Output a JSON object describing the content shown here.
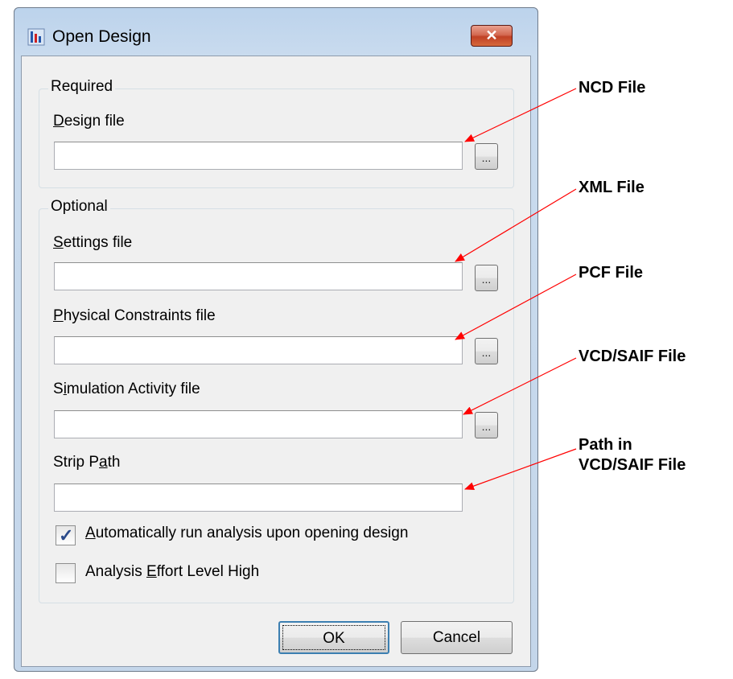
{
  "window": {
    "title": "Open Design",
    "close_glyph": "✕"
  },
  "required_group": {
    "label": "Required",
    "design_file": {
      "mnemonic": "D",
      "rest": "esign file",
      "value": ""
    }
  },
  "optional_group": {
    "label": "Optional",
    "settings_file": {
      "mnemonic": "S",
      "rest": "ettings file",
      "value": ""
    },
    "physical_constraints_file": {
      "mnemonic": "P",
      "rest": "hysical Constraints file",
      "value": ""
    },
    "simulation_activity_file": {
      "pre": "S",
      "mnemonic": "i",
      "rest": "mulation Activity file",
      "value": ""
    },
    "strip_path": {
      "pre": "Strip P",
      "mnemonic": "a",
      "rest": "th",
      "value": ""
    },
    "auto_run": {
      "mnemonic": "A",
      "rest": "utomatically run analysis upon opening design",
      "checked": true
    },
    "effort_high": {
      "pre": "Analysis ",
      "mnemonic": "E",
      "rest": "ffort Level High",
      "checked": false
    }
  },
  "browse_label": "...",
  "buttons": {
    "ok": "OK",
    "cancel": "Cancel"
  },
  "annotations": {
    "ncd": "NCD File",
    "xml": "XML File",
    "pcf": "PCF File",
    "vcd": "VCD/SAIF File",
    "path_line1": "Path in",
    "path_line2": "VCD/SAIF File"
  },
  "colors": {
    "arrow": "#ff0000",
    "check": "#2a4a8a",
    "close_button": "#c04125"
  }
}
